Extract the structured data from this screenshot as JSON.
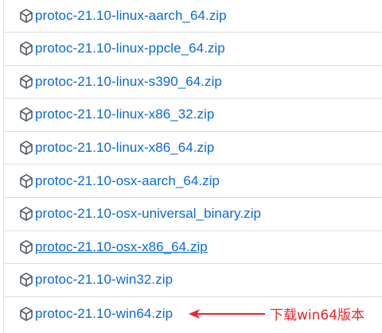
{
  "colors": {
    "link": "#0969da",
    "icon": "#57606a",
    "border": "#d8dee4",
    "annotation": "#e8262a"
  },
  "assets": [
    {
      "name": "protoc-21.10-linux-aarch_64.zip",
      "icon": "package-icon"
    },
    {
      "name": "protoc-21.10-linux-ppcle_64.zip",
      "icon": "package-icon"
    },
    {
      "name": "protoc-21.10-linux-s390_64.zip",
      "icon": "package-icon"
    },
    {
      "name": "protoc-21.10-linux-x86_32.zip",
      "icon": "package-icon"
    },
    {
      "name": "protoc-21.10-linux-x86_64.zip",
      "icon": "package-icon"
    },
    {
      "name": "protoc-21.10-osx-aarch_64.zip",
      "icon": "package-icon"
    },
    {
      "name": "protoc-21.10-osx-universal_binary.zip",
      "icon": "package-icon"
    },
    {
      "name": "protoc-21.10-osx-x86_64.zip",
      "icon": "package-icon",
      "hovered": true
    },
    {
      "name": "protoc-21.10-win32.zip",
      "icon": "package-icon"
    },
    {
      "name": "protoc-21.10-win64.zip",
      "icon": "package-icon"
    }
  ],
  "annotation": {
    "text": "下载win64版本",
    "icon": "arrow-left-icon"
  }
}
